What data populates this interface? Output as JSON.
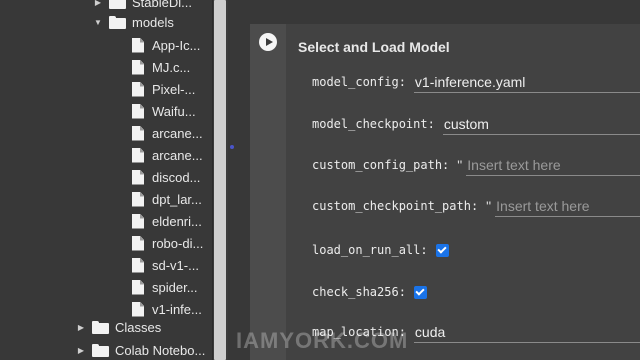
{
  "file_tree": {
    "items": [
      {
        "label": "StableDi...",
        "type": "folder",
        "indent": 1,
        "caret": "right"
      },
      {
        "label": "models",
        "type": "folder",
        "indent": 1,
        "caret": "down"
      },
      {
        "label": "App-Ic...",
        "type": "file",
        "indent": 2
      },
      {
        "label": "MJ.c...",
        "type": "file",
        "indent": 2
      },
      {
        "label": "Pixel-...",
        "type": "file",
        "indent": 2
      },
      {
        "label": "Waifu...",
        "type": "file",
        "indent": 2
      },
      {
        "label": "arcane...",
        "type": "file",
        "indent": 2
      },
      {
        "label": "arcane...",
        "type": "file",
        "indent": 2
      },
      {
        "label": "discod...",
        "type": "file",
        "indent": 2
      },
      {
        "label": "dpt_lar...",
        "type": "file",
        "indent": 2
      },
      {
        "label": "eldenri...",
        "type": "file",
        "indent": 2
      },
      {
        "label": "robo-di...",
        "type": "file",
        "indent": 2
      },
      {
        "label": "sd-v1-...",
        "type": "file",
        "indent": 2
      },
      {
        "label": "spider...",
        "type": "file",
        "indent": 2
      },
      {
        "label": "v1-infe...",
        "type": "file",
        "indent": 2
      },
      {
        "label": "Classes",
        "type": "folder",
        "indent": 0,
        "caret": "right"
      },
      {
        "label": "Colab Notebo...",
        "type": "folder",
        "indent": 0,
        "caret": "right"
      }
    ]
  },
  "cell": {
    "title": "Select and Load Model",
    "params": [
      {
        "label": "model_config:",
        "kind": "text",
        "value": "v1-inference.yaml"
      },
      {
        "label": "model_checkpoint:",
        "kind": "text",
        "value": "custom"
      },
      {
        "label": "custom_config_path:",
        "kind": "string",
        "quote": "\"",
        "placeholder": "Insert text here"
      },
      {
        "label": "custom_checkpoint_path:",
        "kind": "string",
        "quote": "\"",
        "placeholder": "Insert text here"
      },
      {
        "label": "load_on_run_all:",
        "kind": "checkbox",
        "checked": true
      },
      {
        "label": "check_sha256:",
        "kind": "checkbox",
        "checked": true
      },
      {
        "label": "map_location:",
        "kind": "text",
        "value": "cuda"
      }
    ]
  },
  "watermark": "IAMYORK.COM",
  "colors": {
    "checkbox": "#1a73e8",
    "background": "#383838",
    "cell": "#424242"
  }
}
